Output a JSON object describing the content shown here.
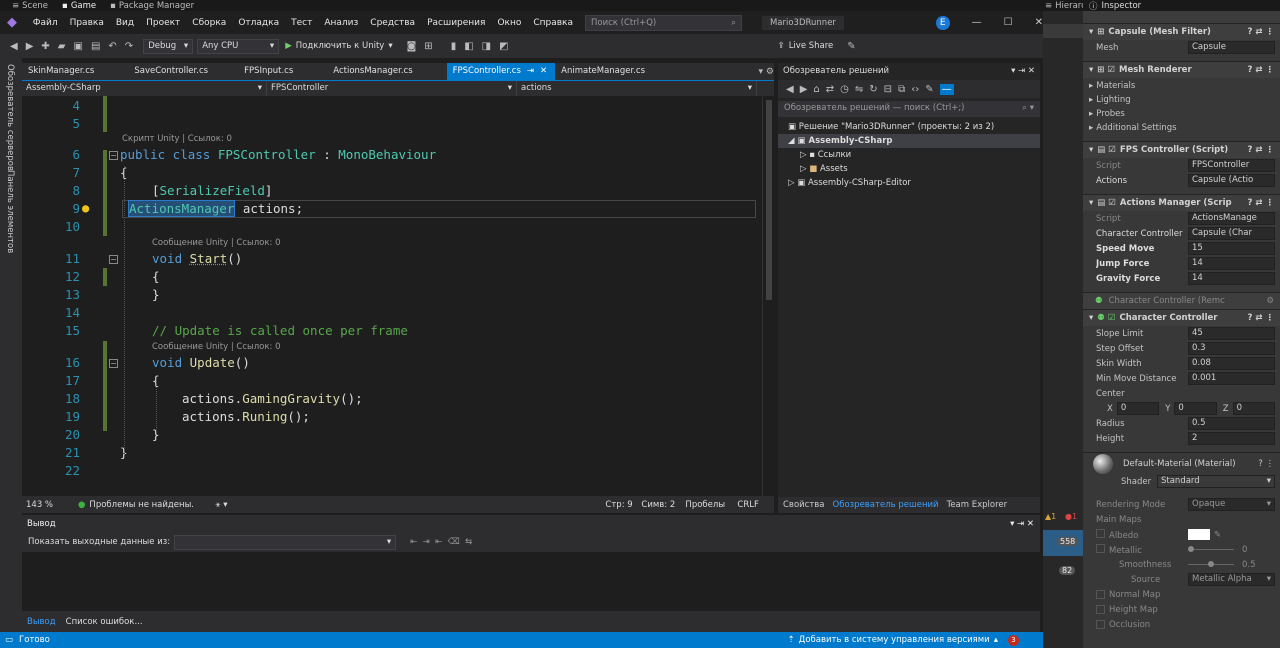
{
  "unity_top": {
    "tabs": [
      "Scene",
      "Game",
      "Package Manager"
    ],
    "hierarchy": "Hierarchy",
    "inspector": "Inspector"
  },
  "menu": {
    "items": [
      "Файл",
      "Правка",
      "Вид",
      "Проект",
      "Сборка",
      "Отладка",
      "Тест",
      "Анализ",
      "Средства",
      "Расширения",
      "Окно",
      "Справка"
    ],
    "search_placeholder": "Поиск (Ctrl+Q)",
    "project": "Mario3DRunner",
    "avatar": "E"
  },
  "toolbar": {
    "config": "Debug",
    "platform": "Any CPU",
    "run": "Подключить к Unity",
    "live_share": "Live Share"
  },
  "rail": {
    "servers": "Обозреватель серверов",
    "toolbox": "Панель элементов"
  },
  "tabs": [
    "SkinManager.cs",
    "SaveController.cs",
    "FPSInput.cs",
    "ActionsManager.cs",
    "FPSController.cs",
    "AnimateManager.cs"
  ],
  "active_tab": "FPSController.cs",
  "navbar": {
    "project": "Assembly-CSharp",
    "class": "FPSController",
    "member": "actions"
  },
  "code": {
    "lines": [
      "4",
      "5",
      "6",
      "7",
      "8",
      "9",
      "10",
      "11",
      "12",
      "13",
      "14",
      "15",
      "16",
      "17",
      "18",
      "19",
      "20",
      "21",
      "22"
    ],
    "lens1": "Скрипт Unity | Ссылок: 0",
    "lens2": "Сообщение Unity | Ссылок: 0",
    "lens3": "Сообщение Unity | Ссылок: 0",
    "l6a": "public class ",
    "l6b": "FPSController",
    "l6c": " : ",
    "l6d": "MonoBehaviour",
    "l7": "{",
    "l8a": "[",
    "l8b": "SerializeField",
    "l8c": "]",
    "l9a": "ActionsManager",
    "l9b": " actions;",
    "l11a": "void ",
    "l11b": "Start",
    "l11c": "()",
    "l12": "{",
    "l13": "}",
    "l15": "// Update is called once per frame",
    "l16a": "void ",
    "l16b": "Update",
    "l16c": "()",
    "l17": "{",
    "l18a": "actions.",
    "l18b": "GamingGravity",
    "l18c": "();",
    "l19a": "actions.",
    "l19b": "Runing",
    "l19c": "();",
    "l20": "}",
    "l21": "}"
  },
  "editor_status": {
    "zoom": "143 %",
    "problems": "Проблемы не найдены.",
    "line": "Стр: 9",
    "col": "Симв: 2",
    "spaces": "Пробелы",
    "eol": "CRLF"
  },
  "solution": {
    "title": "Обозреватель решений",
    "search": "Обозреватель решений — поиск (Ctrl+;)",
    "solution": "Решение \"Mario3DRunner\" (проекты: 2 из 2)",
    "proj": "Assembly-CSharp",
    "refs": "Ссылки",
    "assets": "Assets",
    "editor": "Assembly-CSharp-Editor",
    "tabs": [
      "Свойства",
      "Обозреватель решений",
      "Team Explorer"
    ]
  },
  "output": {
    "title": "Вывод",
    "show_from": "Показать выходные данные из:",
    "bottom_tabs": [
      "Вывод",
      "Список ошибок..."
    ]
  },
  "status": {
    "ready": "Готово",
    "vcs": "Добавить в систему управления версиями",
    "badge": "3"
  },
  "hier_badges": [
    "558",
    "82"
  ],
  "inspector": {
    "mesh_filter": "Capsule (Mesh Filter)",
    "mesh_label": "Mesh",
    "mesh_value": "Capsule",
    "mesh_renderer": "Mesh Renderer",
    "mr_items": [
      "Materials",
      "Lighting",
      "Probes",
      "Additional Settings"
    ],
    "fps": "FPS Controller (Script)",
    "script_label": "Script",
    "fps_script": "FPSController",
    "actions_label": "Actions",
    "actions_value": "Capsule (Actio",
    "am": "Actions Manager (Scrip",
    "am_script": "ActionsManage",
    "cc_label": "Character Controller",
    "cc_value": "Capsule (Char",
    "speed_label": "Speed Move",
    "speed": "15",
    "jump_label": "Jump Force",
    "jump": "14",
    "grav_label": "Gravity Force",
    "grav": "14",
    "cc_remove": "Character Controller (Remc",
    "cc": "Character Controller",
    "slope_label": "Slope Limit",
    "slope": "45",
    "step_label": "Step Offset",
    "step": "0.3",
    "skin_label": "Skin Width",
    "skin": "0.08",
    "minmove_label": "Min Move Distance",
    "minmove": "0.001",
    "center_label": "Center",
    "cx": "0",
    "cy": "0",
    "cz": "0",
    "radius_label": "Radius",
    "radius": "0.5",
    "height_label": "Height",
    "height": "2",
    "material": "Default-Material (Material)",
    "shader_label": "Shader",
    "shader": "Standard",
    "render_label": "Rendering Mode",
    "render": "Opaque",
    "main_maps": "Main Maps",
    "albedo": "Albedo",
    "metallic": "Metallic",
    "metallic_v": "0",
    "smooth": "Smoothness",
    "smooth_v": "0.5",
    "source": "Source",
    "source_v": "Metallic Alpha",
    "normal": "Normal Map",
    "heightmap": "Height Map",
    "occlusion": "Occlusion"
  }
}
